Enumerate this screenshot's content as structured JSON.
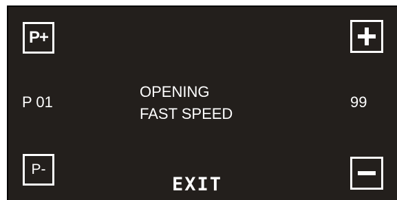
{
  "buttons": {
    "p_plus_label": "P+",
    "p_minus_label": "P-",
    "plus_icon": "plus-icon",
    "minus_icon": "minus-icon",
    "exit_label": "EXIT"
  },
  "display": {
    "parameter": "P 01",
    "label_line1": "OPENING",
    "label_line2": "FAST SPEED",
    "value": "99"
  },
  "colors": {
    "background": "#231f1c",
    "foreground": "#ffffff"
  }
}
